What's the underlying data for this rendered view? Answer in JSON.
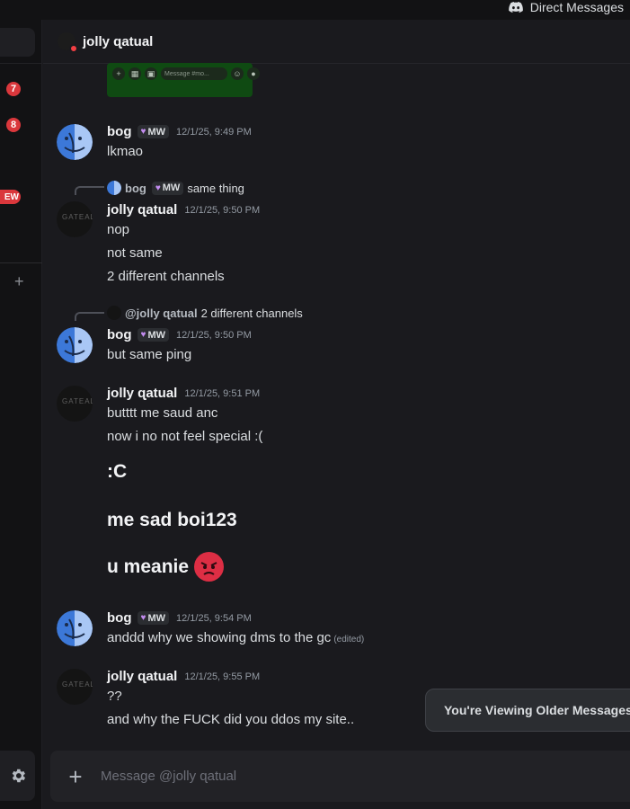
{
  "titlebar": {
    "title": "Direct Messages"
  },
  "rail": {
    "badges": [
      "7",
      "8"
    ],
    "new_pill": "EW",
    "add_label": "+"
  },
  "header": {
    "name": "jolly ɋatual"
  },
  "embed": {
    "placeholder": "Message #mo...",
    "buttons": [
      "+",
      "▦",
      "▣"
    ]
  },
  "messages": [
    {
      "author": "bog",
      "tag": "MW",
      "time": "12/1/25, 9:49 PM",
      "lines": [
        "lkmao"
      ]
    },
    {
      "reply_to": {
        "name": "bog",
        "tag": "MW",
        "text": "same thing"
      },
      "author": "jolly ɋatual",
      "time": "12/1/25, 9:50 PM",
      "lines": [
        "nop",
        "not same",
        "2 different channels"
      ]
    },
    {
      "reply_to": {
        "name": "@jolly ɋatual",
        "text": "2 different channels"
      },
      "author": "bog",
      "tag": "MW",
      "time": "12/1/25, 9:50 PM",
      "lines": [
        "but same ping"
      ]
    },
    {
      "author": "jolly ɋatual",
      "time": "12/1/25, 9:51 PM",
      "lines": [
        "butttt me saud anc",
        "now i no not feel special :("
      ],
      "big_lines": [
        ":C",
        "me sad boi123",
        "u meanie"
      ]
    },
    {
      "author": "bog",
      "tag": "MW",
      "time": "12/1/25, 9:54 PM",
      "lines": [
        "anddd why we showing dms to the gc"
      ],
      "edited": "(edited)"
    },
    {
      "author": "jolly ɋatual",
      "time": "12/1/25, 9:55 PM",
      "lines": [
        "??",
        "and why the FUCK did you ddos my site.."
      ]
    }
  ],
  "older_banner": "You're Viewing Older Messages",
  "composer": {
    "placeholder": "Message @jolly ɋatual",
    "add_label": "+"
  },
  "colors": {
    "accent": "#5865f2",
    "badge": "#da373c",
    "background": "#1a1a1e"
  },
  "icons": [
    "discord-icon",
    "gear-icon",
    "plus-icon",
    "angry-face-emoji"
  ]
}
